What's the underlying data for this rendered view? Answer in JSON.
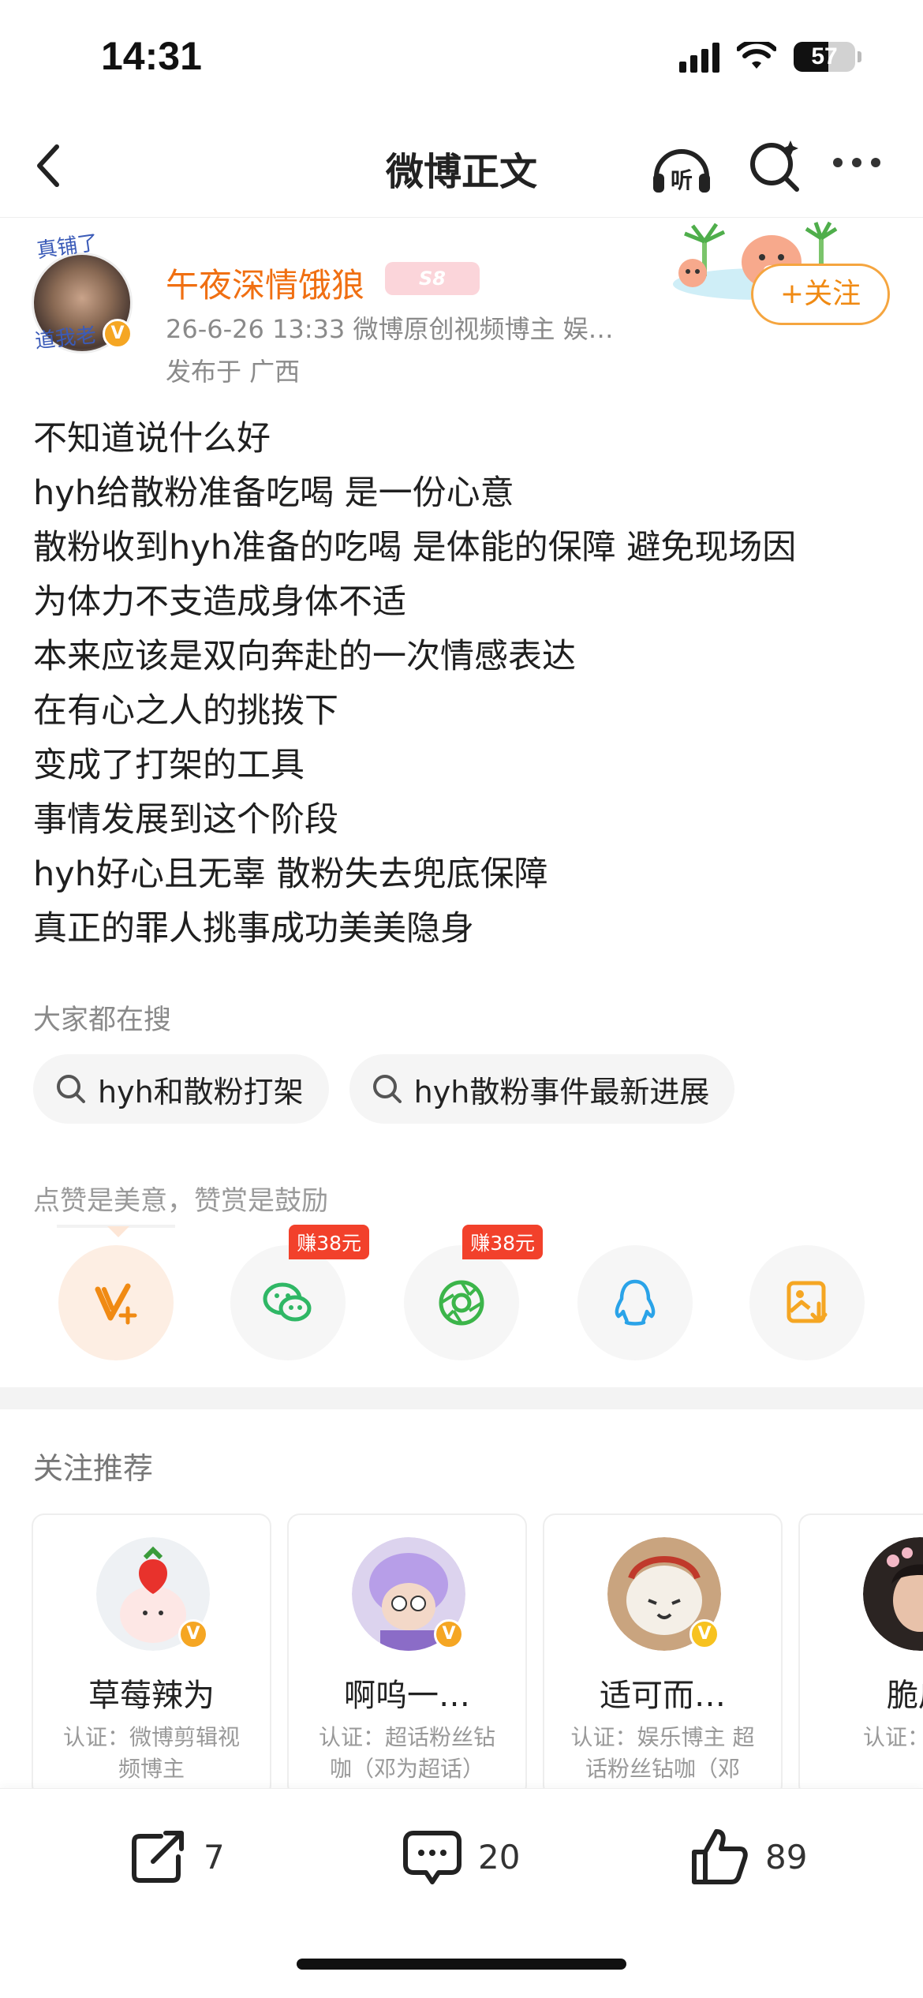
{
  "status_bar": {
    "time": "14:31",
    "battery": "57"
  },
  "nav": {
    "title": "微博正文",
    "listen_label": "听"
  },
  "author": {
    "avatar_text_top": "真铺了",
    "avatar_text_bottom": "道我老",
    "name": "午夜深情饿狼",
    "level_badge": "S8",
    "meta": "26-6-26 13:33  微博原创视频博主 娱…",
    "location": "发布于 广西",
    "follow_label": "+关注"
  },
  "post": {
    "lines": [
      "不知道说什么好",
      "hyh给散粉准备吃喝 是一份心意",
      "散粉收到hyh准备的吃喝 是体能的保障 避免现场因",
      "为体力不支造成身体不适",
      "本来应该是双向奔赴的一次情感表达",
      "在有心之人的挑拨下",
      "变成了打架的工具",
      "事情发展到这个阶段",
      "hyh好心且无辜 散粉失去兜底保障",
      "真正的罪人挑事成功美美隐身"
    ]
  },
  "search": {
    "label": "大家都在搜",
    "chips": [
      "hyh和散粉打架",
      "hyh散粉事件最新进展"
    ]
  },
  "reward": {
    "label": "点赞是美意，赞赏是鼓励",
    "wechat_tag": "赚38元",
    "moments_tag": "赚38元"
  },
  "recommend": {
    "title": "关注推荐",
    "cards": [
      {
        "name": "草莓辣为",
        "desc": "认证：微博剪辑视频博主"
      },
      {
        "name": "啊呜一…",
        "desc": "认证：超话粉丝钻咖（邓为超话）微…"
      },
      {
        "name": "适可而…",
        "desc": "认证：娱乐博主 超话粉丝钻咖（邓为…"
      },
      {
        "name": "脆皮",
        "desc": "认证：微博"
      }
    ]
  },
  "bottom_bar": {
    "reposts": "7",
    "comments": "20",
    "likes": "89"
  },
  "colors": {
    "accent": "#f06f12",
    "follow_border": "#f5a53f",
    "earn_tag": "#f2412b"
  }
}
